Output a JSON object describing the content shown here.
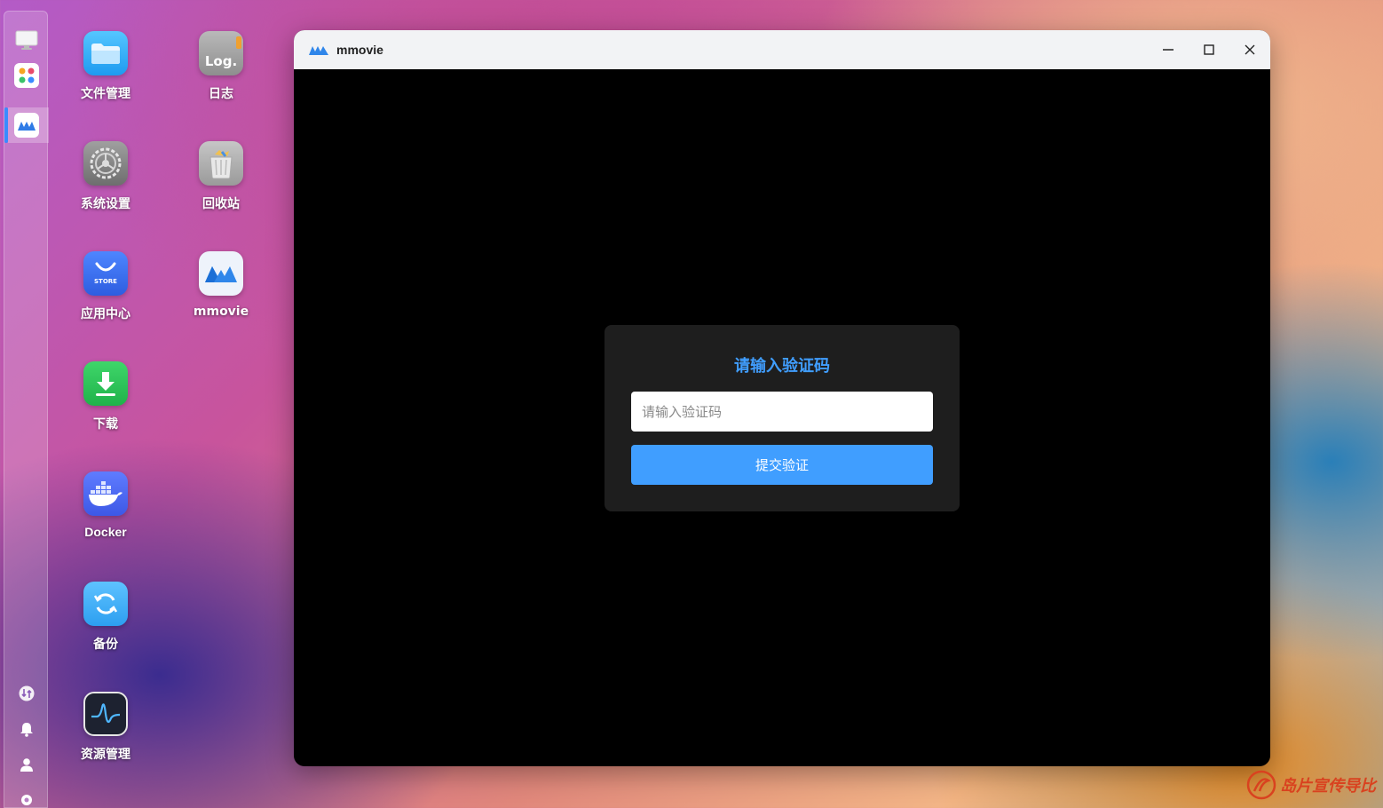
{
  "sidebar": {
    "items": [
      {
        "name": "desktop"
      },
      {
        "name": "app-launcher"
      },
      {
        "name": "mmovie",
        "active": true
      }
    ],
    "bottom": [
      {
        "name": "transfer"
      },
      {
        "name": "notifications"
      },
      {
        "name": "user"
      },
      {
        "name": "settings"
      }
    ]
  },
  "desktop": {
    "icons": [
      {
        "label": "文件管理",
        "icon": "folder-icon"
      },
      {
        "label": "日志",
        "icon": "log-icon",
        "tile_text": "Log."
      },
      {
        "label": "系统设置",
        "icon": "gear-icon"
      },
      {
        "label": "回收站",
        "icon": "trash-icon"
      },
      {
        "label": "应用中心",
        "icon": "store-icon",
        "tile_text": "STORE"
      },
      {
        "label": "mmovie",
        "icon": "mmovie-icon"
      },
      {
        "label": "下载",
        "icon": "download-icon"
      },
      {
        "label": "Docker",
        "icon": "docker-icon"
      },
      {
        "label": "备份",
        "icon": "backup-icon"
      },
      {
        "label": "资源管理",
        "icon": "activity-monitor-icon"
      }
    ]
  },
  "window": {
    "title": "mmovie",
    "controls": {
      "minimize": "minimize-icon",
      "maximize": "maximize-icon",
      "close": "close-icon"
    }
  },
  "verify": {
    "title": "请输入验证码",
    "input_placeholder": "请输入验证码",
    "input_value": "",
    "submit_label": "提交验证"
  },
  "colors": {
    "accent": "#409eff",
    "card_bg": "#1e1e1e",
    "window_bg": "#000000",
    "titlebar_bg": "#f2f3f5"
  },
  "watermark": {
    "text": "岛片宣传导比"
  }
}
